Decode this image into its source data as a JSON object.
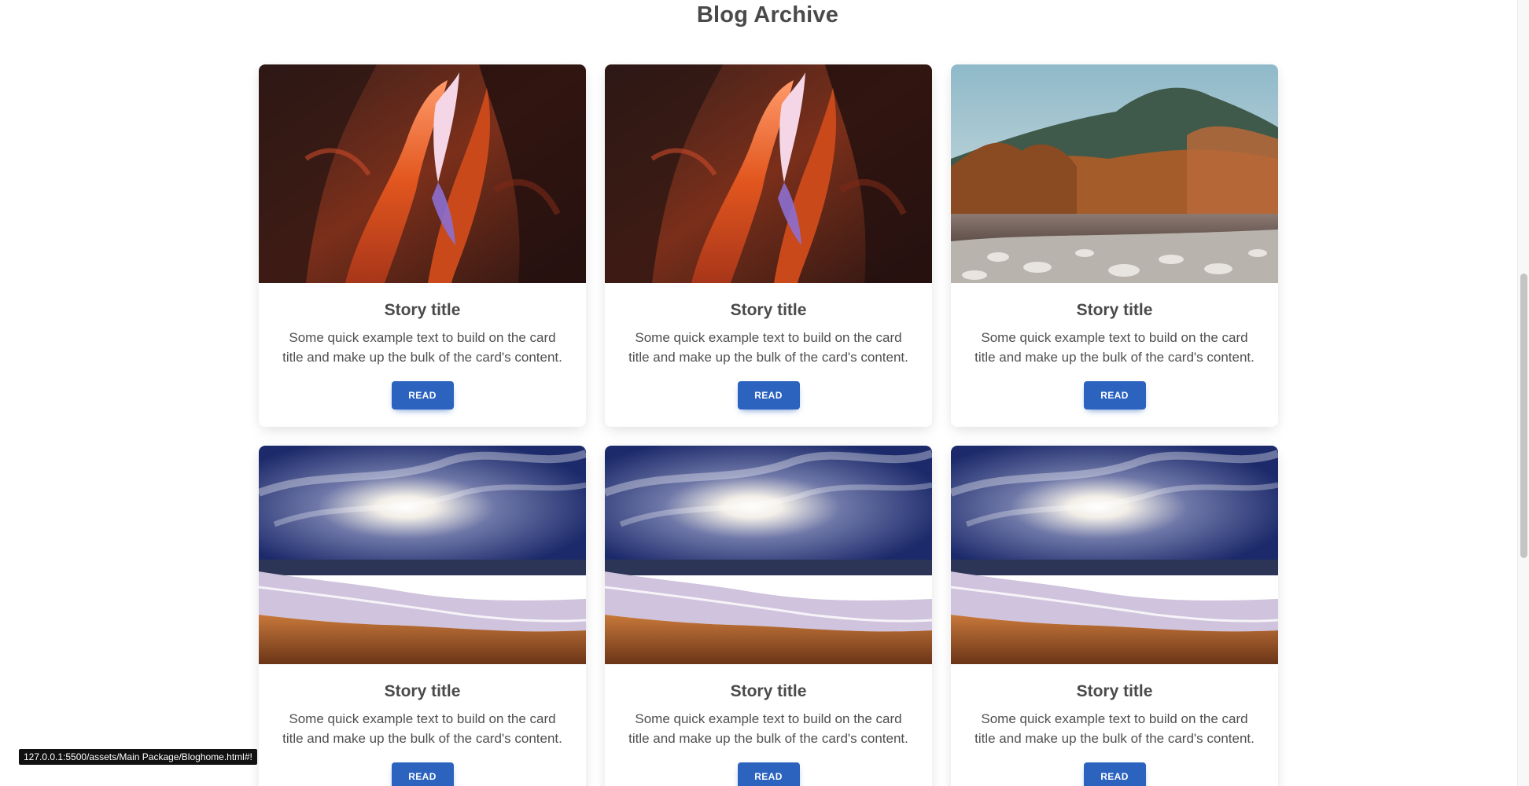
{
  "page": {
    "title": "Blog Archive"
  },
  "cards": [
    {
      "image": "canyon-photo",
      "title": "Story title",
      "text": "Some quick example text to build on the card title and make up the bulk of the card's content.",
      "button_label": "READ"
    },
    {
      "image": "canyon-photo",
      "title": "Story title",
      "text": "Some quick example text to build on the card title and make up the bulk of the card's content.",
      "button_label": "READ"
    },
    {
      "image": "autumn-river-photo",
      "title": "Story title",
      "text": "Some quick example text to build on the card title and make up the bulk of the card's content.",
      "button_label": "READ"
    },
    {
      "image": "beach-sunset-photo",
      "title": "Story title",
      "text": "Some quick example text to build on the card title and make up the bulk of the card's content.",
      "button_label": "READ"
    },
    {
      "image": "beach-sunset-photo",
      "title": "Story title",
      "text": "Some quick example text to build on the card title and make up the bulk of the card's content.",
      "button_label": "READ"
    },
    {
      "image": "beach-sunset-photo",
      "title": "Story title",
      "text": "Some quick example text to build on the card title and make up the bulk of the card's content.",
      "button_label": "READ"
    }
  ],
  "status_bar": {
    "url": "127.0.0.1:5500/assets/Main Package/Bloghome.html#!"
  },
  "colors": {
    "button": "#2b63bf",
    "text": "#4f4f4f",
    "title": "#4a4a4a"
  }
}
